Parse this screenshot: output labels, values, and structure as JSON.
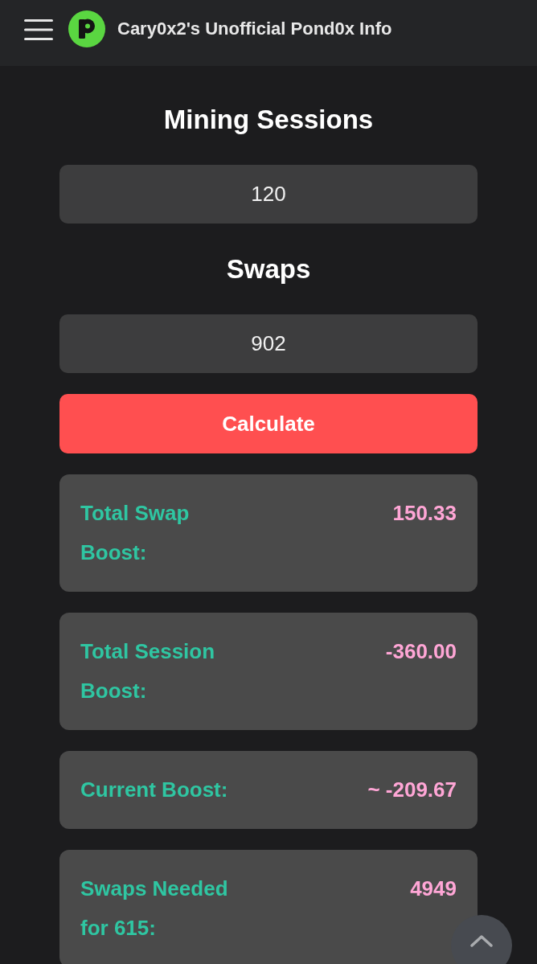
{
  "header": {
    "title": "Cary0x2's Unofficial Pond0x Info"
  },
  "inputs": [
    {
      "label": "Mining Sessions",
      "value": "120"
    },
    {
      "label": "Swaps",
      "value": "902"
    }
  ],
  "button": {
    "label": "Calculate"
  },
  "results": [
    {
      "label": "Total Swap Boost:",
      "value": "150.33"
    },
    {
      "label": "Total Session Boost:",
      "value": "-360.00"
    },
    {
      "label": "Current Boost:",
      "value": "~ -209.67"
    },
    {
      "label": "Swaps Needed for 615:",
      "value": "4949"
    }
  ]
}
